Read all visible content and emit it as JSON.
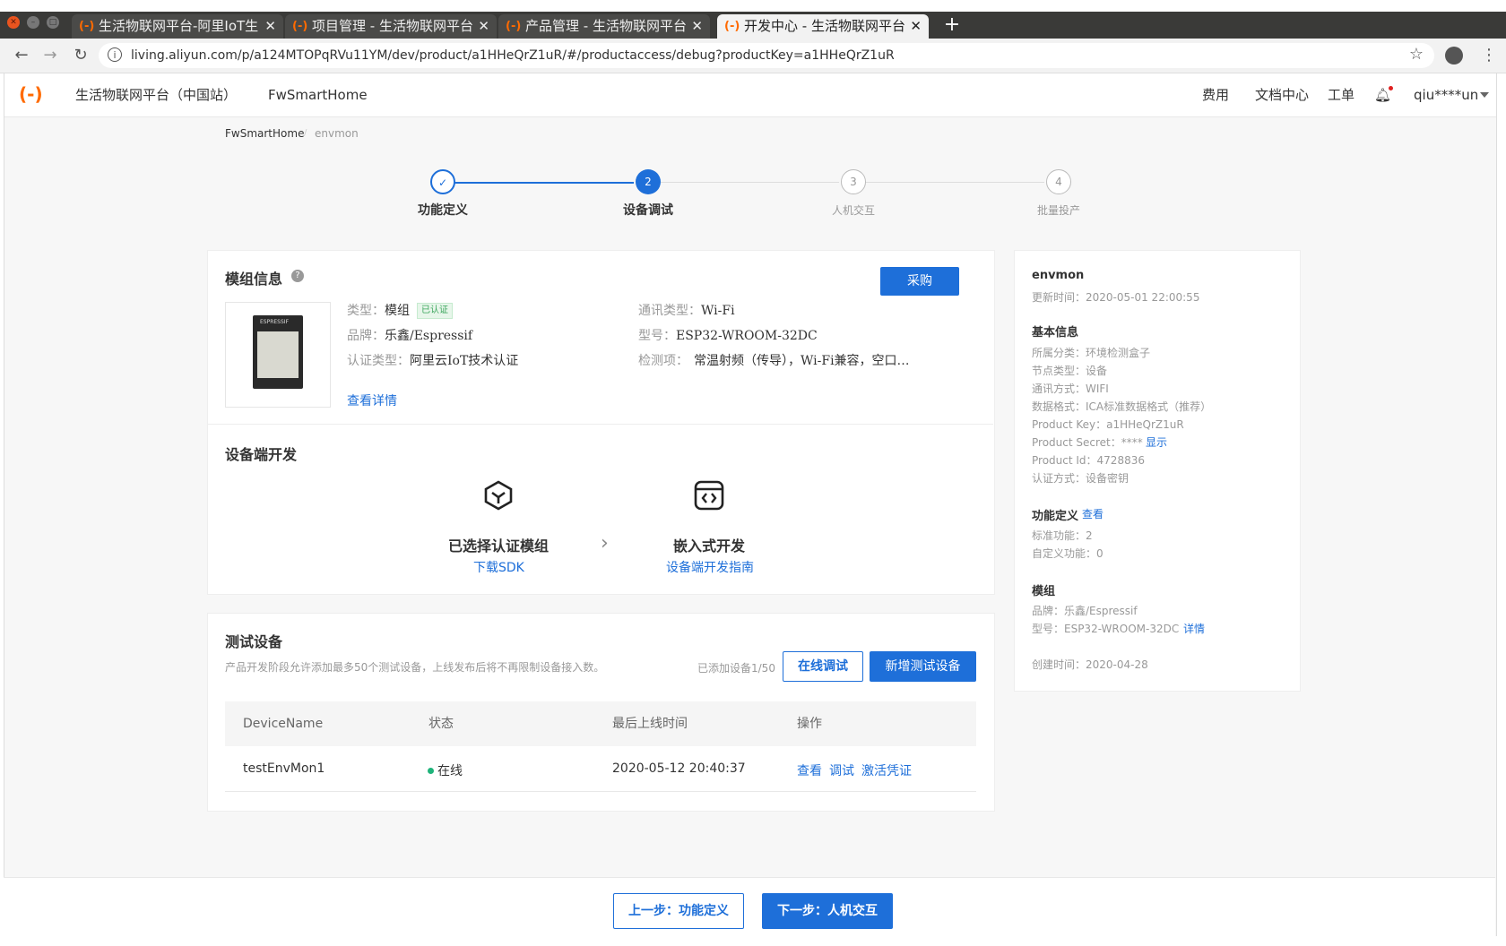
{
  "browser": {
    "tabs": [
      {
        "title": "生活物联网平台-阿里IoT生"
      },
      {
        "title": "项目管理 - 生活物联网平台"
      },
      {
        "title": "产品管理 - 生活物联网平台"
      },
      {
        "title": "开发中心 - 生活物联网平台"
      }
    ],
    "url": "living.aliyun.com/p/a124MTOPqRVu11YM/dev/product/a1HHeQrZ1uR/#/productaccess/debug?productKey=a1HHeQrZ1uR"
  },
  "header": {
    "platform": "生活物联网平台（中国站）",
    "project": "FwSmartHome",
    "fees": "费用",
    "docs": "文档中心",
    "tickets": "工单",
    "user": "qiu****un"
  },
  "breadcrumb": {
    "root": "FwSmartHome",
    "sep": "/",
    "current": "envmon"
  },
  "steps": [
    {
      "num": "✓",
      "label": "功能定义"
    },
    {
      "num": "2",
      "label": "设备调试"
    },
    {
      "num": "3",
      "label": "人机交互"
    },
    {
      "num": "4",
      "label": "批量投产"
    }
  ],
  "module": {
    "title": "模组信息",
    "buy": "采购",
    "type_label": "类型：",
    "type_value": "模组",
    "certified": "已认证",
    "brand_label": "品牌：",
    "brand_value": "乐鑫/Espressif",
    "cert_label": "认证类型：",
    "cert_value": "阿里云IoT技术认证",
    "comm_label": "通讯类型：",
    "comm_value": "Wi-Fi",
    "model_label": "型号：",
    "model_value": "ESP32-WROOM-32DC",
    "test_label": "检测项：",
    "test_value": "常温射频（传导），Wi-Fi兼容，空口…",
    "details": "查看详情",
    "chip_text": "ESPRESSIF"
  },
  "devdev": {
    "title": "设备端开发",
    "step1_title": "已选择认证模组",
    "step1_link": "下载SDK",
    "step2_title": "嵌入式开发",
    "step2_link": "设备端开发指南"
  },
  "testdev": {
    "title": "测试设备",
    "desc": "产品开发阶段允许添加最多50个测试设备，上线发布后将不再限制设备接入数。",
    "added": "已添加设备1/50",
    "online_debug": "在线调试",
    "add_device": "新增测试设备",
    "columns": [
      "DeviceName",
      "状态",
      "最后上线时间",
      "操作"
    ],
    "rows": [
      {
        "name": "testEnvMon1",
        "status": "在线",
        "last_online": "2020-05-12 20:40:37",
        "actions": [
          "查看",
          "调试",
          "激活凭证"
        ]
      }
    ],
    "status_color": "#1fb37a"
  },
  "sidebar": {
    "product_name": "envmon",
    "updated": "更新时间：2020-05-01 22:00:55",
    "basic_title": "基本信息",
    "category": "所属分类：环境检测盒子",
    "node_type": "节点类型：设备",
    "comm": "通讯方式：WIFI",
    "data_format": "数据格式：ICA标准数据格式（推荐）",
    "product_key": "Product Key：a1HHeQrZ1uR",
    "product_secret": "Product Secret：****",
    "show": "显示",
    "product_id": "Product Id：4728836",
    "auth": "认证方式：设备密钥",
    "func_title": "功能定义",
    "func_view": "查看",
    "std_func": "标准功能：2",
    "custom_func": "自定义功能：0",
    "module_title": "模组",
    "module_brand": "品牌：乐鑫/Espressif",
    "module_model": "型号：ESP32-WROOM-32DC",
    "module_detail": "详情",
    "created": "创建时间：2020-04-28"
  },
  "footer": {
    "prev": "上一步：功能定义",
    "next": "下一步：人机交互"
  },
  "colors": {
    "accent": "#1e6fd9",
    "brand": "#ff6a00"
  }
}
